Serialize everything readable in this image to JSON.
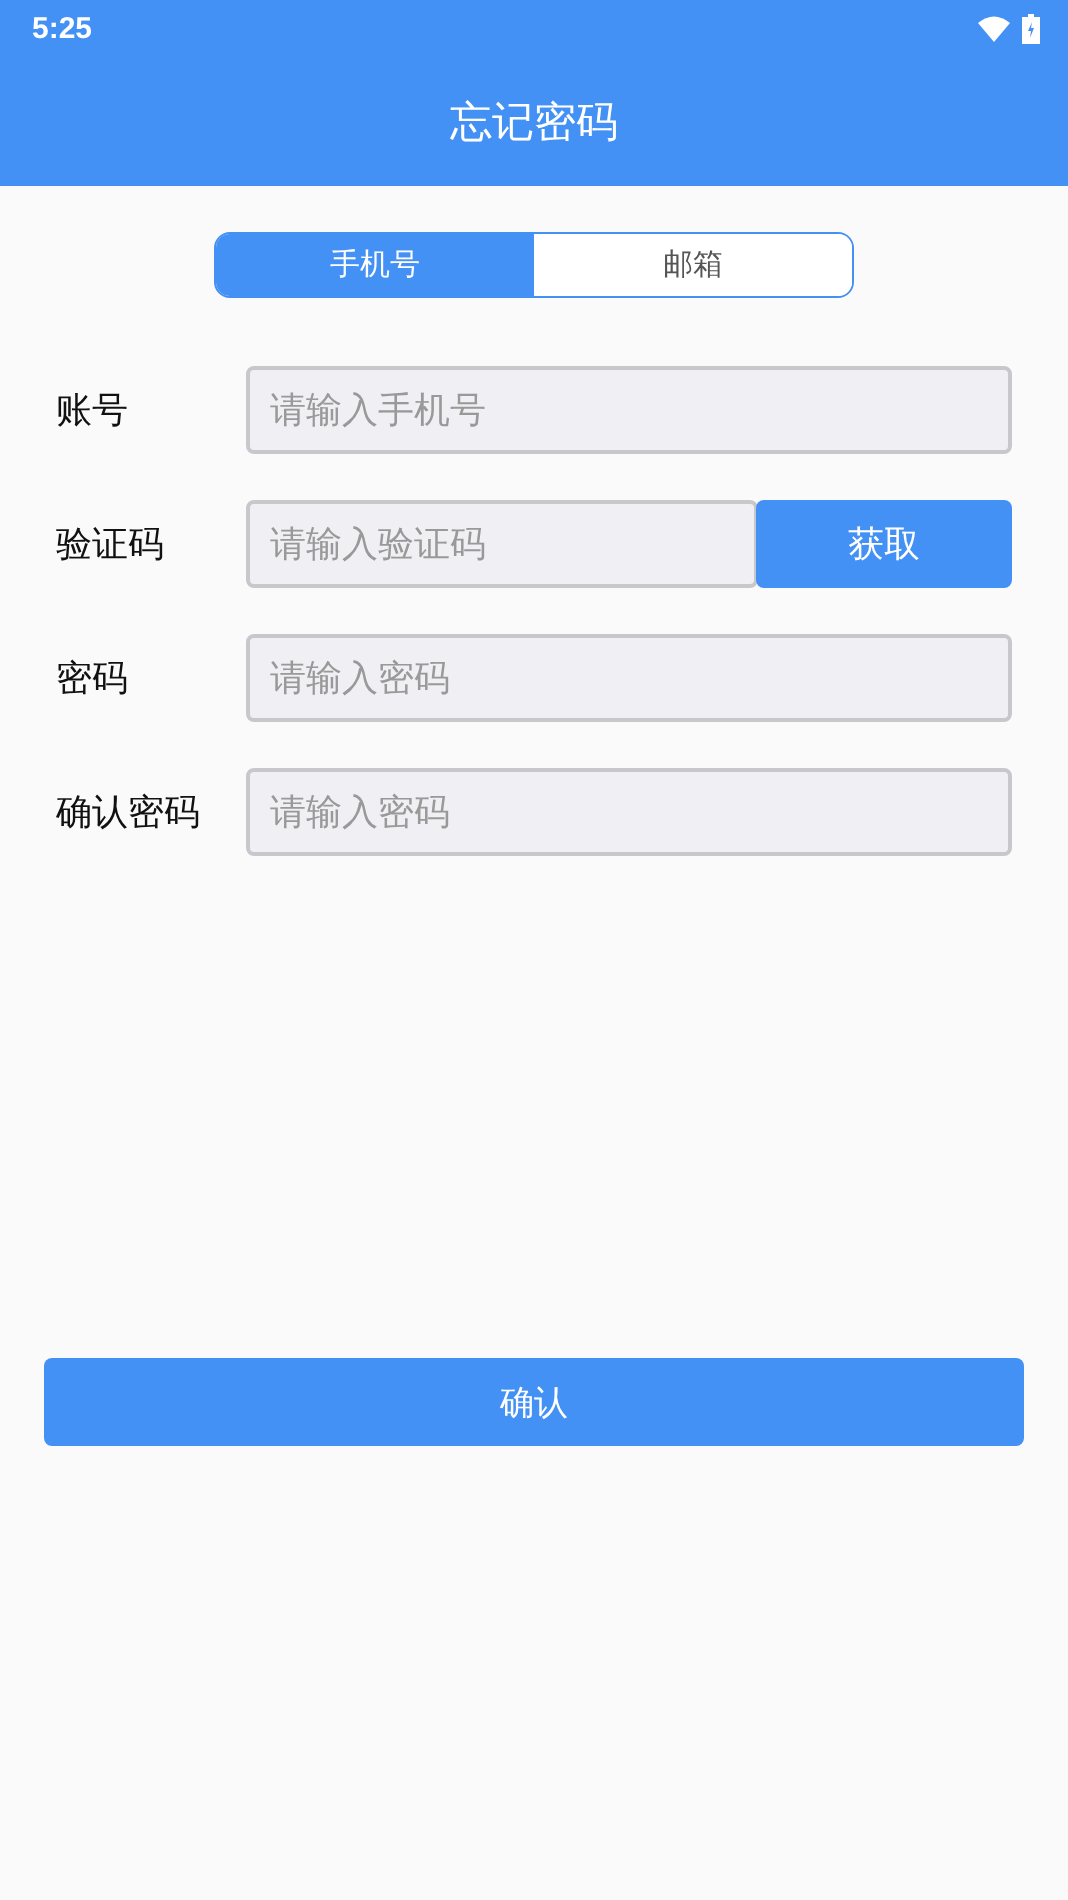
{
  "status_bar": {
    "time": "5:25"
  },
  "title": "忘记密码",
  "tabs": [
    {
      "label": "手机号",
      "selected": true
    },
    {
      "label": "邮箱",
      "selected": false
    }
  ],
  "fields": [
    {
      "label": "账号",
      "placeholder": "请输入手机号"
    },
    {
      "label": "验证码",
      "placeholder": "请输入验证码",
      "action": "获取"
    },
    {
      "label": "密码",
      "placeholder": "请输入密码"
    },
    {
      "label": "确认密码",
      "placeholder": "请输入密码"
    }
  ],
  "submit": "确认"
}
